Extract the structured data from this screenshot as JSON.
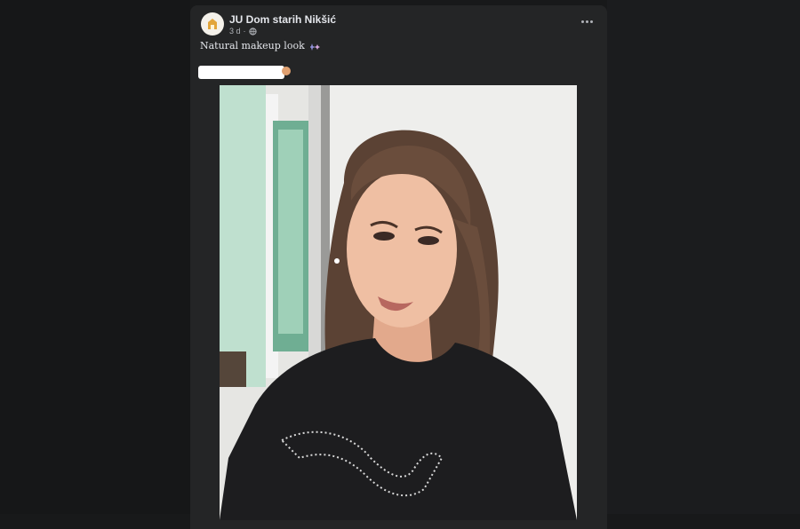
{
  "post": {
    "author": "JU Dom starih Nikšić",
    "timestamp": "3 d",
    "audience_icon": "globe-icon",
    "caption": "Natural makeup look",
    "caption_emoji": "sparkle-icon",
    "more_icon": "more-dots-icon"
  },
  "colors": {
    "page_bg": "#18191a",
    "card_bg": "#242526",
    "primary_text": "#e4e6eb",
    "secondary_text": "#b0b3b8"
  }
}
